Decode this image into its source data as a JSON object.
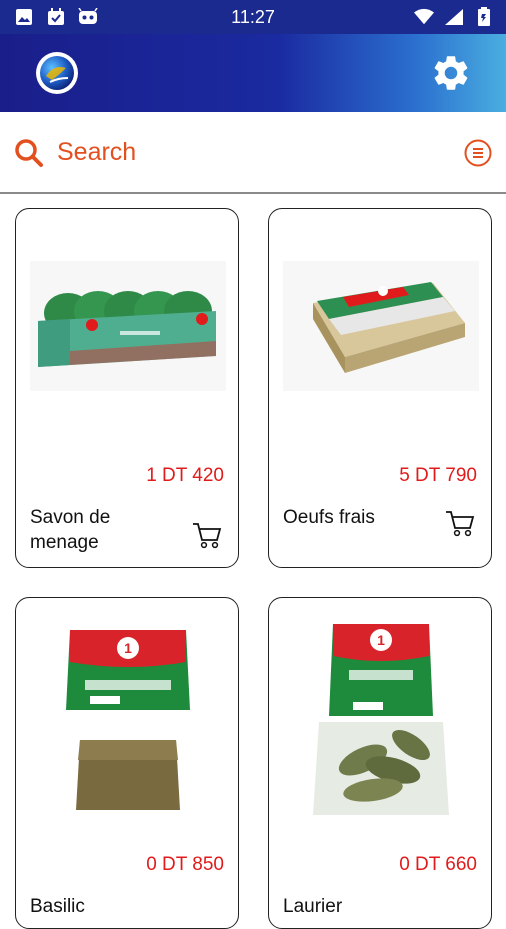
{
  "status_bar": {
    "time": "11:27"
  },
  "search": {
    "label": "Search"
  },
  "colors": {
    "accent": "#e3501f",
    "price": "#e11b1b",
    "appbar_start": "#1a1e8a",
    "appbar_end": "#4aaee0"
  },
  "products": [
    {
      "name": "Savon de menage",
      "price": "1 DT 420"
    },
    {
      "name": "Oeufs frais",
      "price": "5 DT 790"
    },
    {
      "name": "Basilic",
      "price": "0 DT 850"
    },
    {
      "name": "Laurier",
      "price": "0 DT 660"
    }
  ],
  "icons": {
    "status": [
      "image-icon",
      "calendar-check-icon",
      "android-icon",
      "wifi-icon",
      "signal-icon",
      "battery-icon"
    ],
    "app": [
      "logo",
      "settings-gear-icon",
      "search-icon",
      "filter-list-icon",
      "cart-icon"
    ]
  }
}
